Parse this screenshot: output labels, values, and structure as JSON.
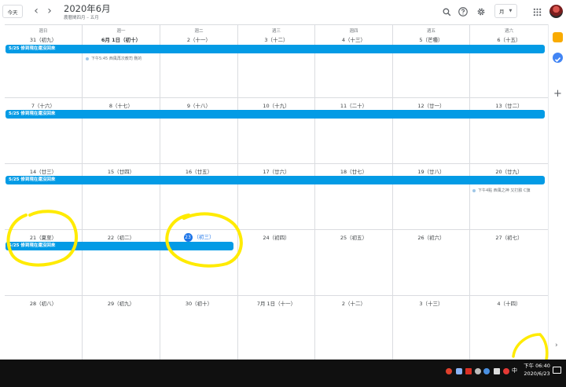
{
  "header": {
    "today_label": "今天",
    "prev_icon": "chevron-left-icon",
    "next_icon": "chevron-right-icon",
    "title": "2020年6月",
    "subtitle": "農曆閏四月 – 五月",
    "view_label": "月",
    "icons": [
      "search-icon",
      "help-icon",
      "gear-icon",
      "apps-grid-icon"
    ]
  },
  "weekdays": [
    "週日",
    "週一",
    "週二",
    "週三",
    "週四",
    "週五",
    "週六"
  ],
  "weeks": [
    {
      "days": [
        "31（初九）",
        "6月 1日（初十）",
        "2（十一）",
        "3（十二）",
        "4（十三）",
        "5（芒種）",
        "6（十五）"
      ]
    },
    {
      "days": [
        "7（十六）",
        "8（十七）",
        "9（十八）",
        "10（十九）",
        "11（二十）",
        "12（廿一）",
        "13（廿二）"
      ]
    },
    {
      "days": [
        "14（廿三）",
        "15（廿四）",
        "16（廿五）",
        "17（廿六）",
        "18（廿七）",
        "19（廿八）",
        "20（廿九）"
      ]
    },
    {
      "days": [
        "21（夏至）",
        "22（初二）",
        "23",
        "24（初四）",
        "25（初五）",
        "26（初六）",
        "27（初七）"
      ]
    },
    {
      "days": [
        "28（初八）",
        "29（初九）",
        "30（初十）",
        "7月 1日（十一）",
        "2（十二）",
        "3（十三）",
        "4（十四）"
      ]
    }
  ],
  "today": {
    "number": "23",
    "lunar": "（初三）"
  },
  "events": {
    "recurring_title": "5/25 修到現在還沒回來",
    "small_event_1": "下午5:45 西風再次教司 刪的",
    "small_event_2": "下午4點 西風之神 又打臉 C旗"
  },
  "taskbar": {
    "time": "下午 06:40",
    "date": "2020/6/23",
    "ime_label": "中"
  },
  "colors": {
    "accent": "#1a73e8",
    "event": "#039be5",
    "annotation": "#ffeb00",
    "taskbar": "#101010"
  }
}
